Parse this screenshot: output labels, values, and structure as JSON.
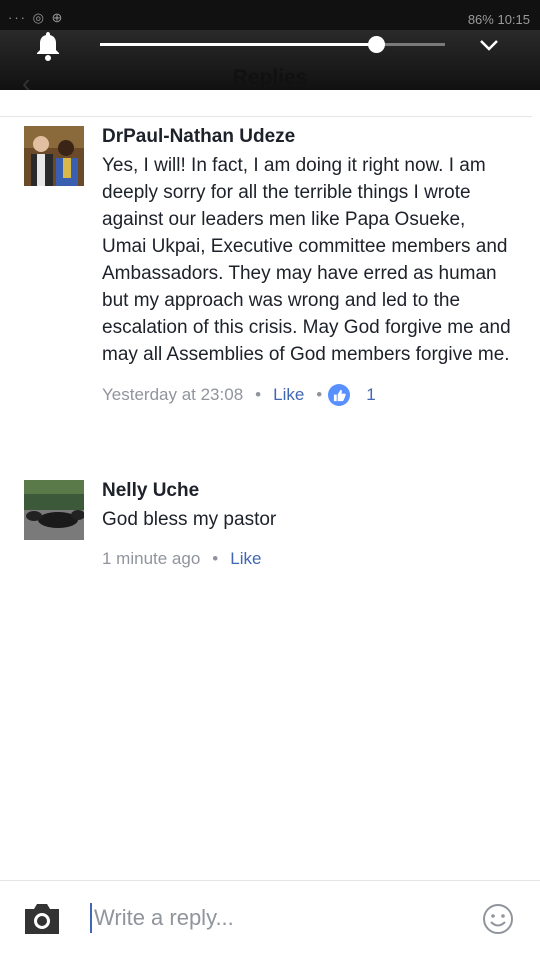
{
  "status": {
    "left": "··· ◎ ⊕",
    "right": "86%  10:15"
  },
  "header": {
    "title": "Replies"
  },
  "comments": [
    {
      "author": "DrPaul-Nathan Udeze",
      "text": "Yes, I will! In fact, I am doing it right now. I am deeply sorry for all the terrible things I wrote against our leaders men like Papa Osueke, Umai Ukpai, Executive committee members and Ambassadors. They may have erred as human but my approach was wrong and led to the escalation of this crisis. May God forgive me and may all Assemblies of God members forgive me.",
      "time": "Yesterday at 23:08",
      "like": "Like",
      "reaction_count": "1"
    },
    {
      "author": "Nelly Uche",
      "text": "God bless my pastor",
      "time": "1 minute ago",
      "like": "Like"
    }
  ],
  "reply": {
    "placeholder": "Write a reply..."
  },
  "brightness": 0.8
}
